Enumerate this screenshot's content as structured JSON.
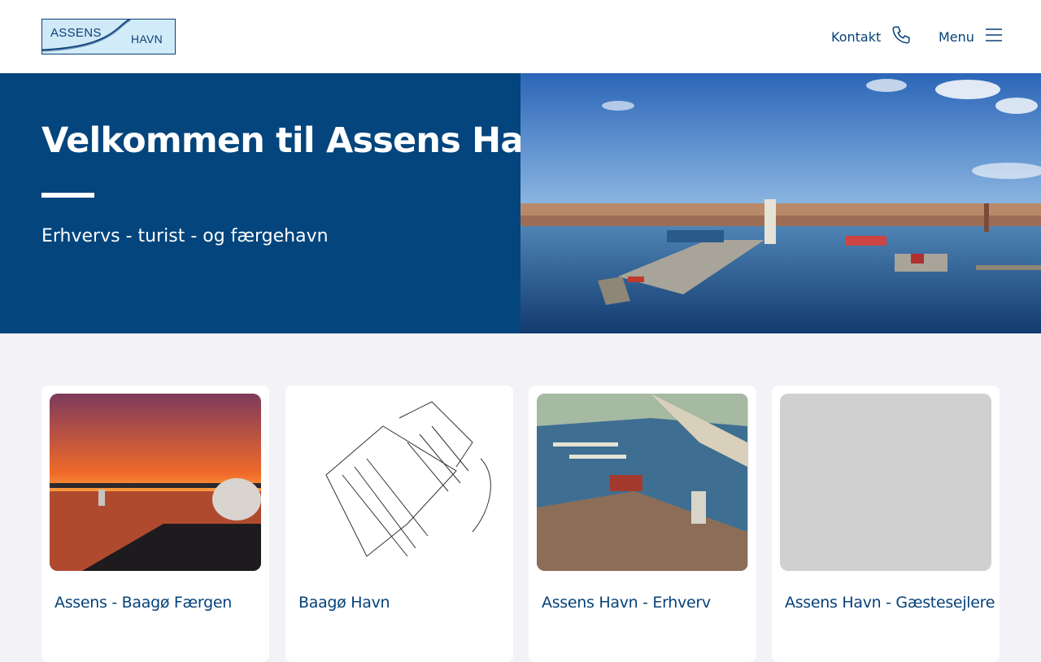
{
  "header": {
    "logo": {
      "word1": "ASSENS",
      "word2": "HAVN"
    },
    "kontakt_label": "Kontakt",
    "menu_label": "Menu",
    "icons": {
      "kontakt": "phone-icon",
      "menu": "hamburger-menu-icon"
    }
  },
  "hero": {
    "title": "Velkommen til Assens Havn",
    "subtitle": "Erhvervs - turist - og færgehavn"
  },
  "cards": [
    {
      "title": "Assens - Baagø Færgen"
    },
    {
      "title": "Baagø Havn"
    },
    {
      "title": "Assens Havn - Erhverv"
    },
    {
      "title": "Assens Havn - Gæstesejlere"
    }
  ],
  "colors": {
    "brand_blue": "#03457c",
    "text_blue": "#05427a",
    "page_bg": "#f2f2f7",
    "logo_bg": "#cfe9f7"
  }
}
